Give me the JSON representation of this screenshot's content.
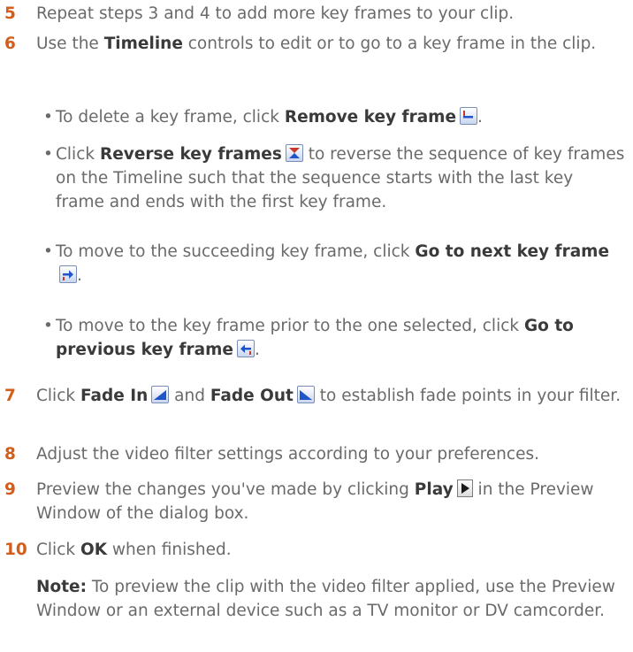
{
  "steps": {
    "s5": {
      "num": "5",
      "text": "Repeat steps 3 and 4 to add more key frames to your clip."
    },
    "s6": {
      "num": "6",
      "pre": "Use the ",
      "kw": "Timeline",
      "post": " controls to edit or to go to a key frame in the clip."
    },
    "s7": {
      "num": "7",
      "pre": "Click ",
      "kw1": "Fade In",
      "mid": " and ",
      "kw2": "Fade Out",
      "post": " to establish fade points in your filter."
    },
    "s8": {
      "num": "8",
      "text": "Adjust the video filter settings according to your preferences."
    },
    "s9": {
      "num": "9",
      "pre": "Preview the changes you've made by clicking ",
      "kw": "Play",
      "post": " in the Preview Window of the dialog box."
    },
    "s10": {
      "num": "10",
      "pre": "Click ",
      "kw": "OK",
      "post": " when finished."
    }
  },
  "bullets": {
    "b1": {
      "pre": "To delete a key frame, click ",
      "kw": "Remove key frame",
      "post": "."
    },
    "b2": {
      "pre": "Click ",
      "kw": "Reverse key frames",
      "post": " to reverse the sequence of key frames on the Timeline such that the sequence starts with the last key frame and ends with the first key frame."
    },
    "b3": {
      "pre": "To move to the succeeding key frame, click ",
      "kw": "Go to next key frame",
      "post": "."
    },
    "b4": {
      "pre": "To move to the key frame prior to the one selected, click ",
      "kw": "Go to previous key frame",
      "post": "."
    }
  },
  "note": {
    "label": "Note:",
    "text": "  To preview the clip with the video filter applied, use the Preview Window or an external device such as a TV monitor or DV camcorder."
  },
  "icons": {
    "remove": "remove-key-frame-icon",
    "reverse": "reverse-key-frames-icon",
    "next": "go-to-next-key-frame-icon",
    "prev": "go-to-previous-key-frame-icon",
    "fadein": "fade-in-icon",
    "fadeout": "fade-out-icon",
    "play": "play-icon"
  },
  "colors": {
    "step_number": "#d35d1b",
    "body_text": "#6a6a6a",
    "keyword": "#3a3a3a"
  }
}
